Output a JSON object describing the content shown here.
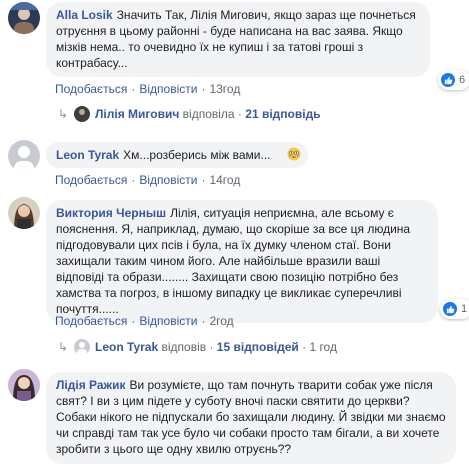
{
  "comments": [
    {
      "author": "Alla Losik",
      "text": "Значить Так, Лілія Мигович, якщо зараз ще почнеться отруєння в цьому районні - буде написана на вас заява. Якщо мізків нема.. то очевидно їх не купиш і за татові гроші з контрабасу...",
      "actions": {
        "like": "Подобається",
        "reply": "Відповісти",
        "time": "13год"
      },
      "likes": "6",
      "reply_summary": {
        "name": "Лілія Мигович",
        "verb": "відповіла",
        "count": "21 відповідь"
      }
    },
    {
      "author": "Leon Tyrak",
      "text": "Хм...розберись між вами...",
      "actions": {
        "like": "Подобається",
        "reply": "Відповісти",
        "time": "14год"
      }
    },
    {
      "author": "Виктория Черныш",
      "text": "Лілія, ситуація неприємна, але всьому є пояснення. Я, наприклад, думаю, що скоріше за все ця людина підгодовували цих псів і була, на їх думку членом стаї. Вони захищали таким чином його. Але найбільше вразили ваші відповіді та образи........ Захищати свою позицію потрібно без хамства та погроз, в іншому випадку це викликає суперечливі почуття......",
      "actions": {
        "like": "Подобається",
        "reply": "Відповісти",
        "time": "2год"
      },
      "likes": "1",
      "reply_summary": {
        "name": "Leon Tyrak",
        "verb": "відповів",
        "count": "15 відповідей",
        "time": "1 год"
      }
    },
    {
      "author": "Лідія Ражик",
      "text": "Ви розумієте, що там почнуть тварити собак уже після свят? І ви з цим підете у суботу вночі паски святити до церкви? Собаки нікого не підпускали бо захищали людину. Й звідки ми знаємо чи справді там так усе було чи собаки просто там бігали, а ви хочете зробити з цього ще одну хвилю отруєнь??"
    }
  ],
  "colors": {
    "link": "#385898",
    "bubble": "#f2f3f5",
    "like_blue": "#1877f2"
  }
}
